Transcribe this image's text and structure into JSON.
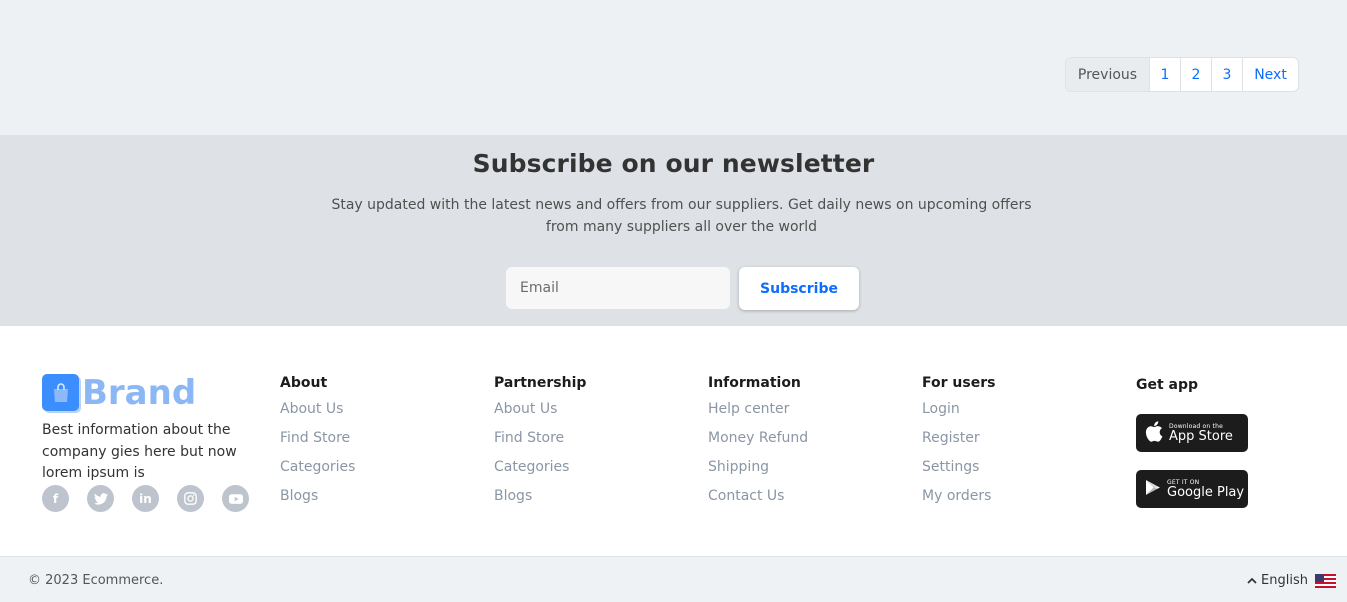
{
  "pagination": {
    "previous": "Previous",
    "pages": [
      "1",
      "2",
      "3"
    ],
    "next": "Next"
  },
  "newsletter": {
    "title": "Subscribe on our newsletter",
    "description": "Stay updated with the latest news and offers from our suppliers. Get daily news on upcoming offers from many suppliers all over the world",
    "email_placeholder": "Email",
    "button": "Subscribe"
  },
  "footer": {
    "brand": {
      "name": "Brand",
      "description": "Best information about the company gies here but now lorem ipsum is",
      "icon": "shopping-bag-icon"
    },
    "socials": [
      {
        "name": "facebook-icon",
        "glyph": "f"
      },
      {
        "name": "twitter-icon",
        "glyph": "t"
      },
      {
        "name": "linkedin-icon",
        "glyph": "in"
      },
      {
        "name": "instagram-icon",
        "glyph": "◎"
      },
      {
        "name": "youtube-icon",
        "glyph": "▶"
      }
    ],
    "columns": [
      {
        "title": "About",
        "links": [
          "About Us",
          "Find Store",
          "Categories",
          "Blogs"
        ]
      },
      {
        "title": "Partnership",
        "links": [
          "About Us",
          "Find Store",
          "Categories",
          "Blogs"
        ]
      },
      {
        "title": "Information",
        "links": [
          "Help center",
          "Money Refund",
          "Shipping",
          "Contact Us"
        ]
      },
      {
        "title": "For users",
        "links": [
          "Login",
          "Register",
          "Settings",
          "My orders"
        ]
      }
    ],
    "get_app": {
      "title": "Get app",
      "app_store": {
        "small": "Download on the",
        "big": "App Store",
        "icon": "apple-icon"
      },
      "google_play": {
        "small": "GET IT ON",
        "big": "Google Play",
        "icon": "google-play-icon"
      }
    }
  },
  "bottom": {
    "copyright": "© 2023 Ecommerce.",
    "language": "English",
    "language_icon": "chevron-up-icon",
    "flag": "us-flag-icon"
  },
  "colors": {
    "accent": "#0d6efd",
    "brand_icon": "#3c8dfd",
    "brand_text": "#8cb7f5",
    "newsletter_bg": "#dee2e6",
    "pager_bg": "#eef1f4"
  }
}
